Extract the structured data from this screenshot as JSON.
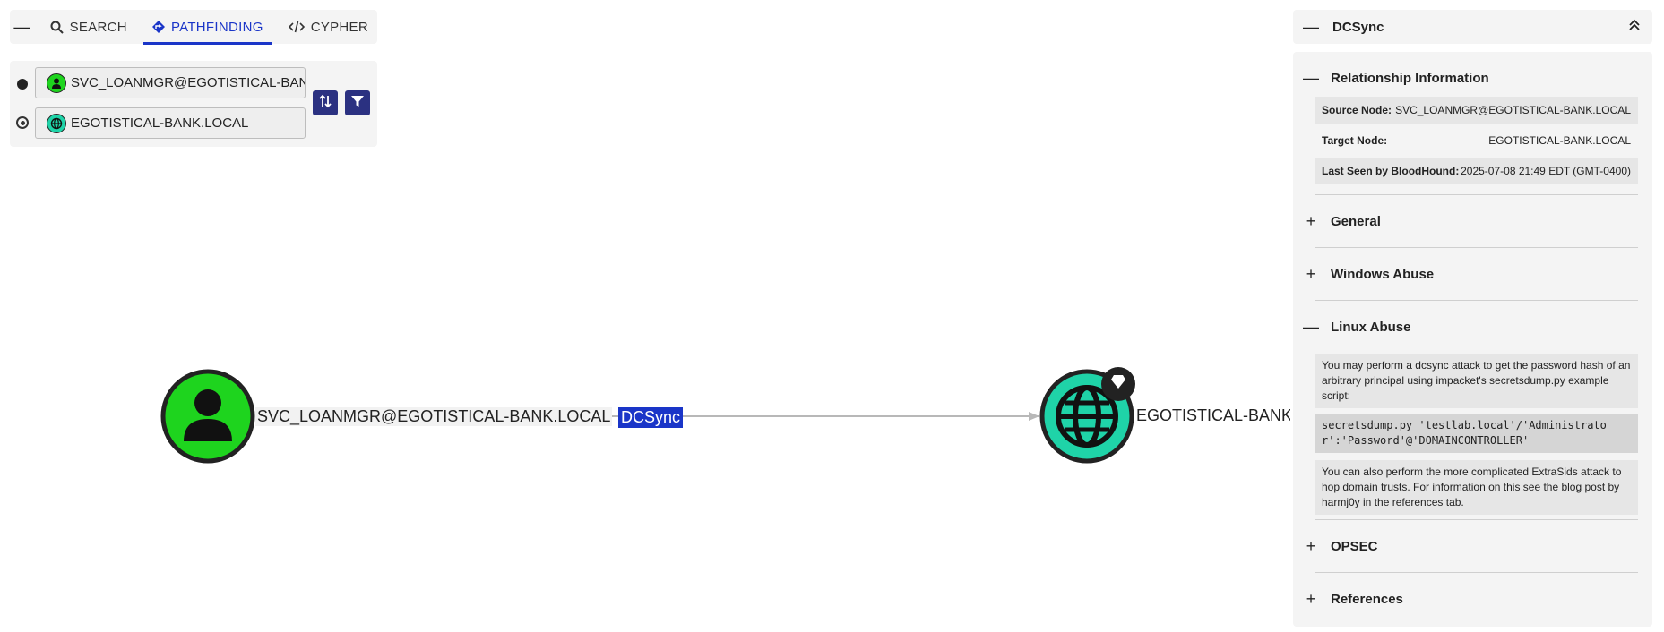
{
  "toolbar": {
    "tabs": [
      {
        "label": "SEARCH",
        "icon": "search-icon"
      },
      {
        "label": "PATHFINDING",
        "icon": "pathfinding-icon"
      },
      {
        "label": "CYPHER",
        "icon": "code-icon"
      }
    ],
    "active_tab": "PATHFINDING"
  },
  "pathfinding": {
    "start_node": "SVC_LOANMGR@EGOTISTICAL-BANK.LOCAL",
    "end_node": "EGOTISTICAL-BANK.LOCAL"
  },
  "graph": {
    "source_label": "SVC_LOANMGR@EGOTISTICAL-BANK.LOCAL",
    "target_label": "EGOTISTICAL-BANK.LOCAL",
    "edge_label": "DCSync",
    "colors": {
      "user_node": "#1ed41e",
      "domain_node": "#1fd3a8",
      "edge_label_bg": "#1a35c8",
      "accent": "#2b3181"
    }
  },
  "panel": {
    "title": "DCSync",
    "relationship": {
      "heading": "Relationship Information",
      "source_key": "Source Node:",
      "source_value": "SVC_LOANMGR@EGOTISTICAL-BANK.LOCAL",
      "target_key": "Target Node:",
      "target_value": "EGOTISTICAL-BANK.LOCAL",
      "lastseen_key": "Last Seen by BloodHound:",
      "lastseen_value": "2025-07-08 21:49 EDT (GMT-0400)"
    },
    "sections": {
      "general": "General",
      "windows_abuse": "Windows Abuse",
      "linux_abuse": "Linux Abuse",
      "opsec": "OPSEC",
      "references": "References"
    },
    "linux_abuse": {
      "text1": "You may perform a dcsync attack to get the password hash of an arbitrary principal using impacket's secretsdump.py example script:",
      "code": "secretsdump.py 'testlab.local'/'Administrator':'Password'@'DOMAINCONTROLLER'",
      "text2": "You can also perform the more complicated ExtraSids attack to hop domain trusts. For information on this see the blog post by harmj0y in the references tab."
    }
  }
}
